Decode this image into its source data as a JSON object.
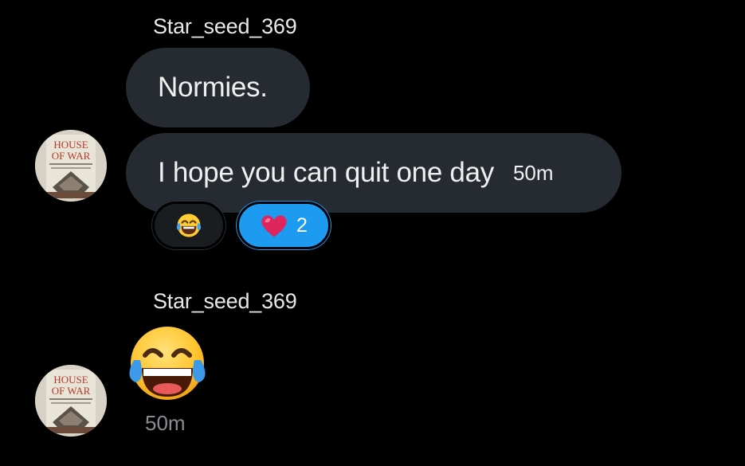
{
  "messages": [
    {
      "username": "Star_seed_369",
      "bubbles": [
        {
          "text": "Normies.",
          "timestamp": ""
        },
        {
          "text": "I hope you can quit one day",
          "timestamp": "50m"
        }
      ],
      "reactions": [
        {
          "emoji": "laughing-tears",
          "count": ""
        },
        {
          "emoji": "heart",
          "count": "2"
        }
      ]
    },
    {
      "username": "Star_seed_369",
      "emoji": "laughing-tears",
      "timestamp": "50m"
    }
  ],
  "avatar": {
    "title_line1": "HOUSE",
    "title_line2": "OF WAR"
  },
  "colors": {
    "background": "#000000",
    "bubble": "#252b31",
    "accent": "#1d9bf0",
    "heart": "#e0245e",
    "muted": "#8a8d91"
  }
}
